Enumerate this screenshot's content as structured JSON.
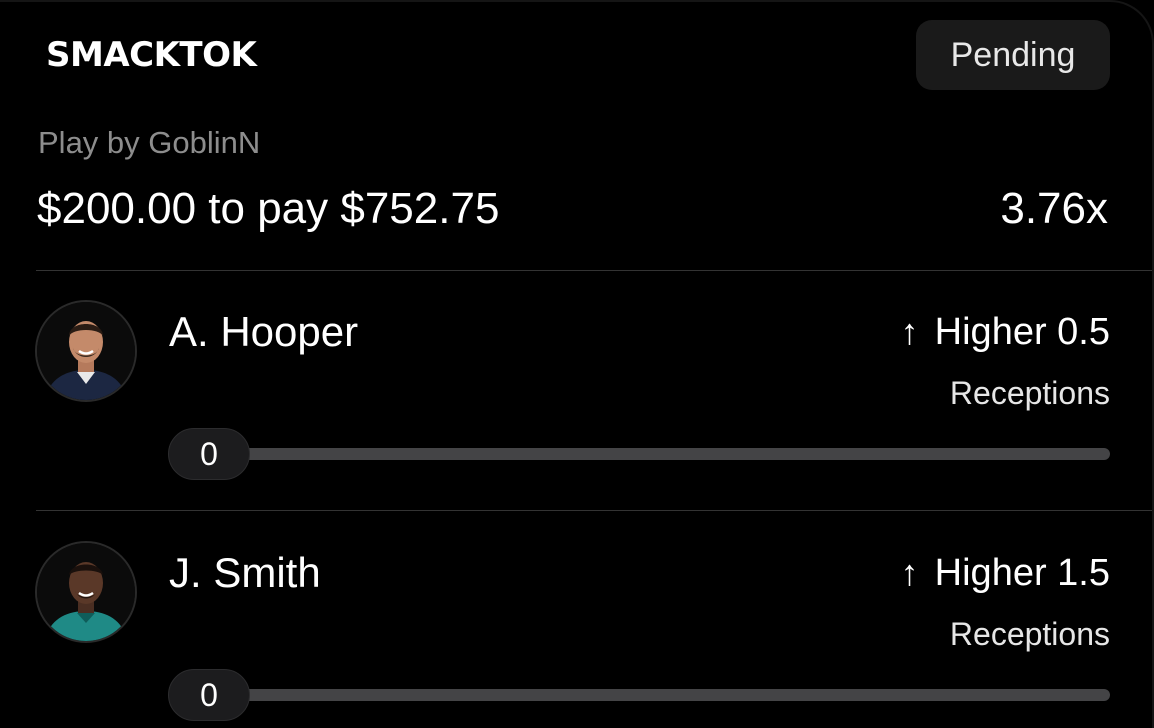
{
  "header": {
    "logo": "SMACKTOK",
    "status": "Pending"
  },
  "summary": {
    "play_by": "Play by GoblinN",
    "wager": "$200.00 to pay $752.75",
    "multiplier": "3.76x"
  },
  "picks": [
    {
      "player": "A. Hooper",
      "arrow": "↑",
      "line": "Higher 0.5",
      "stat": "Receptions",
      "current": "0",
      "progress_fraction": 0,
      "jersey_color": "#1c2742"
    },
    {
      "player": "J. Smith",
      "arrow": "↑",
      "line": "Higher 1.5",
      "stat": "Receptions",
      "current": "0",
      "progress_fraction": 0,
      "jersey_color": "#1f8a86"
    }
  ]
}
